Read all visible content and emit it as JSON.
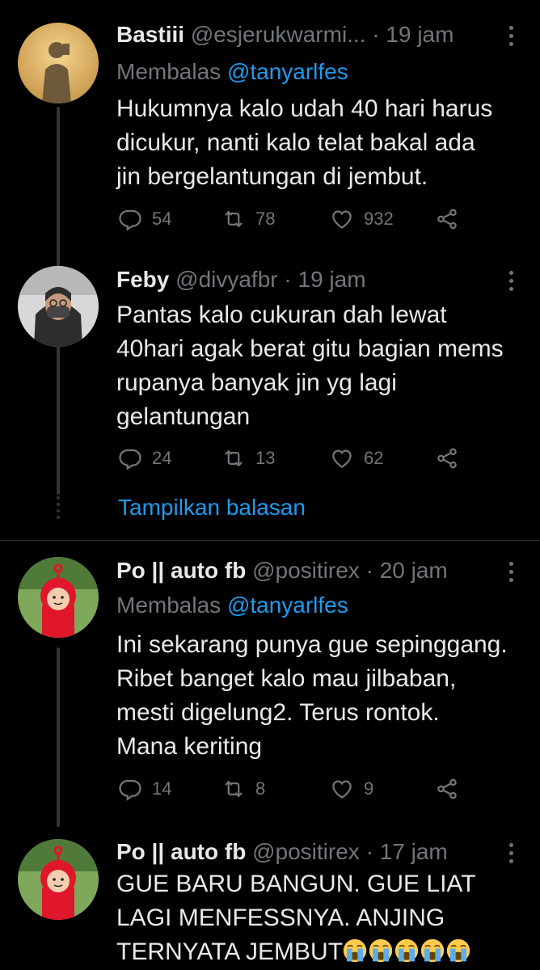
{
  "tweets": [
    {
      "name": "Bastiii",
      "handle": "@esjerukwarmi...",
      "dot": "·",
      "time": "19 jam",
      "replying_prefix": "Membalas ",
      "replying_to": "@tanyarlfes",
      "lines": [
        "Hukumnya kalo udah 40 hari harus",
        "dicukur, nanti kalo telat bakal ada",
        "jin bergelantungan di jembut."
      ],
      "replies": "54",
      "retweets": "78",
      "likes": "932"
    },
    {
      "name": "Feby",
      "handle": "@divyafbr",
      "dot": "·",
      "time": "19 jam",
      "lines": [
        "Pantas kalo cukuran dah lewat",
        "40hari agak berat gitu bagian mems",
        "rupanya banyak jin yg lagi",
        "gelantungan"
      ],
      "replies": "24",
      "retweets": "13",
      "likes": "62"
    },
    {
      "name": "Po || auto fb",
      "handle": "@positirex",
      "dot": "·",
      "time": "20 jam",
      "replying_prefix": "Membalas ",
      "replying_to": "@tanyarlfes",
      "lines": [
        "Ini sekarang punya gue sepinggang.",
        "Ribet banget kalo mau jilbaban,",
        "mesti digelung2. Terus rontok.",
        "Mana keriting"
      ],
      "replies": "14",
      "retweets": "8",
      "likes": "9"
    },
    {
      "name": "Po || auto fb",
      "handle": "@positirex",
      "dot": "·",
      "time": "17 jam",
      "lines": [
        "GUE BARU BANGUN. GUE LIAT",
        "LAGI MENFESSNYA. ANJING",
        "TERNYATA JEMBUT"
      ],
      "emoji": "loudly-crying-face x5"
    }
  ],
  "show_replies": "Tampilkan balasan",
  "colors": {
    "background": "#000000",
    "text": "#e7e9ea",
    "muted": "#71767b",
    "link": "#1d9bf0",
    "line": "#333639"
  }
}
